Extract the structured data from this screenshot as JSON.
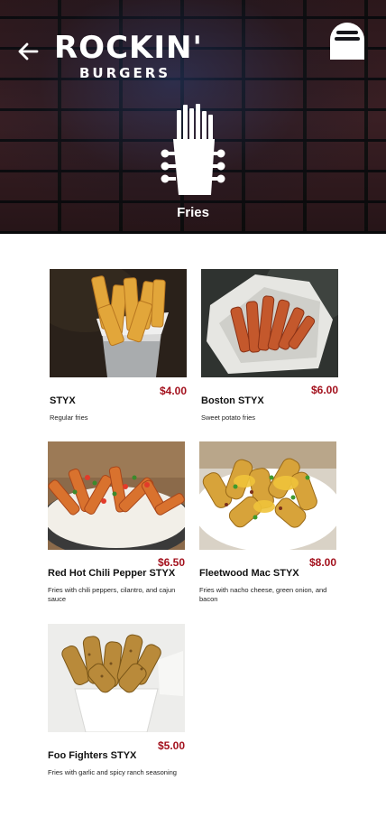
{
  "header": {
    "logo_main": "ROCKIN'",
    "logo_sub": "BURGERS",
    "category": "Fries"
  },
  "icons": {
    "back": "arrow-left-icon",
    "cart": "shopping-bag-icon",
    "category": "guitar-fries-icon"
  },
  "colors": {
    "price": "#a3111d",
    "header_bg": "#17171c"
  },
  "items": [
    {
      "name": "STYX",
      "price": "$4.00",
      "description": "Regular fries"
    },
    {
      "name": "Boston STYX",
      "price": "$6.00",
      "description": "Sweet potato fries"
    },
    {
      "name": "Red Hot Chili Pepper STYX",
      "price": "$6.50",
      "description": "Fries with chili peppers, cilantro, and cajun sauce"
    },
    {
      "name": "Fleetwood Mac STYX",
      "price": "$8.00",
      "description": "Fries with nacho cheese, green onion, and bacon"
    },
    {
      "name": "Foo Fighters STYX",
      "price": "$5.00",
      "description": "Fries with garlic and spicy ranch seasoning"
    }
  ]
}
